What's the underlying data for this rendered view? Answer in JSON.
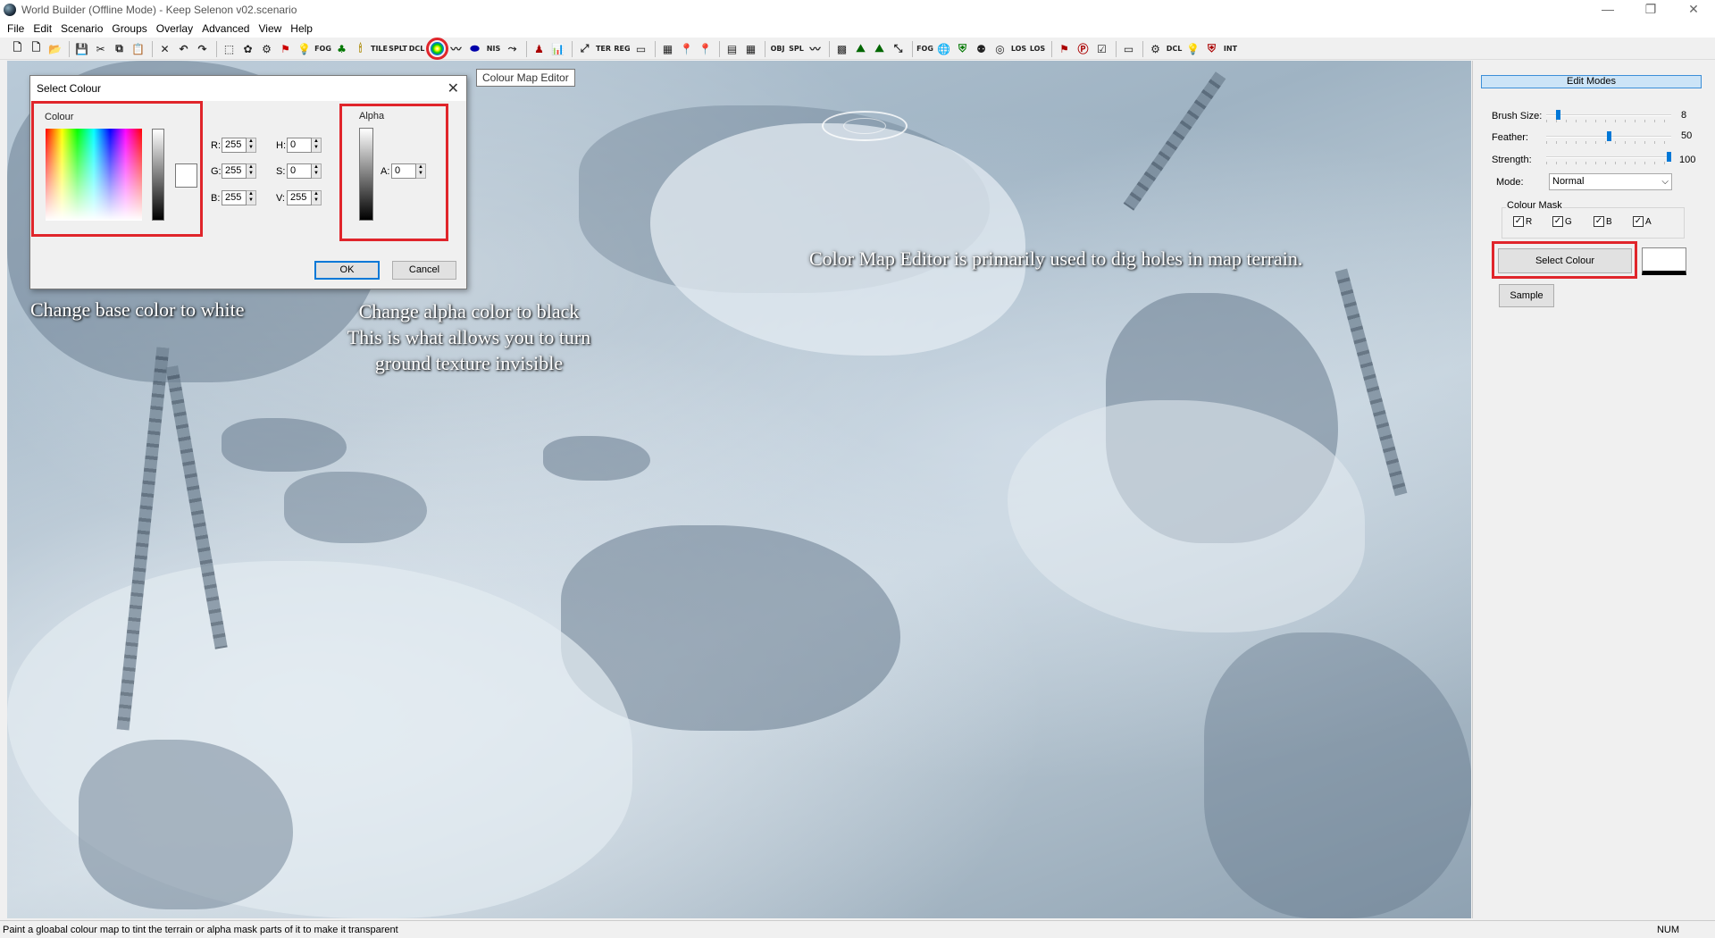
{
  "window": {
    "title": "World Builder (Offline Mode) - Keep Selenon v02.scenario",
    "buttons": [
      "—",
      "❐",
      "✕"
    ]
  },
  "menu": [
    "File",
    "Edit",
    "Scenario",
    "Groups",
    "Overlay",
    "Advanced",
    "View",
    "Help"
  ],
  "toolbar": {
    "text_buttons": {
      "fog": "FOG",
      "tile": "TILE",
      "splt": "SPLT",
      "dcl": "DCL",
      "nis": "NIS",
      "ter": "TER",
      "reg": "REG",
      "obj": "OBJ",
      "spl": "SPL",
      "fog2": "FOG",
      "los": "LOS",
      "los2": "LOS",
      "dcl2": "DCL",
      "int": "INT"
    },
    "tooltip": "Colour Map Editor"
  },
  "dialog": {
    "title": "Select Colour",
    "colour_group": "Colour",
    "alpha_group": "Alpha",
    "fields": [
      {
        "label": "R:",
        "value": "255"
      },
      {
        "label": "G:",
        "value": "255"
      },
      {
        "label": "B:",
        "value": "255"
      },
      {
        "label": "H:",
        "value": "0"
      },
      {
        "label": "S:",
        "value": "0"
      },
      {
        "label": "V:",
        "value": "255"
      }
    ],
    "alpha_field": {
      "label": "A:",
      "value": "0"
    },
    "ok": "OK",
    "cancel": "Cancel"
  },
  "annotations": {
    "base_color": "Change base color to white",
    "alpha_line1": "Change alpha color to black",
    "alpha_line2": "This is what allows you to turn",
    "alpha_line3": "ground texture invisible",
    "editor_note": "Color Map Editor is primarily used to dig holes in map terrain."
  },
  "panel": {
    "header": "Edit Modes",
    "brush_size": {
      "label": "Brush Size:",
      "value": "8",
      "level": 0.08
    },
    "feather": {
      "label": "Feather:",
      "value": "50",
      "level": 0.5
    },
    "strength": {
      "label": "Strength:",
      "value": "100",
      "level": 1.0
    },
    "mode_label": "Mode:",
    "mode_value": "Normal",
    "mask_group": "Colour Mask",
    "mask": [
      {
        "label": "R",
        "checked": true
      },
      {
        "label": "G",
        "checked": true
      },
      {
        "label": "B",
        "checked": true
      },
      {
        "label": "A",
        "checked": true
      }
    ],
    "select_colour": "Select Colour",
    "sample": "Sample"
  },
  "status": {
    "text": "Paint a gloabal colour map to tint the terrain or alpha mask parts of it to make it transparent",
    "num": "NUM"
  },
  "colors": {
    "highlight": "#e0252b",
    "accent": "#0078d7"
  }
}
